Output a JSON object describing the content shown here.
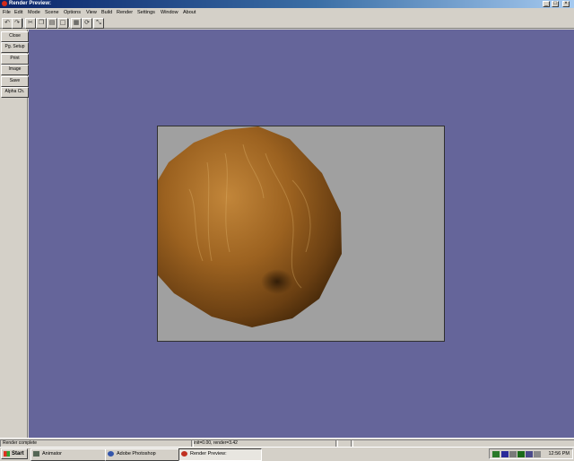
{
  "window": {
    "title": "Render Preview:",
    "icon": "app-icon",
    "controls": {
      "minimize": "_",
      "maximize": "□",
      "close": "×"
    }
  },
  "menu": [
    "File",
    "Edit",
    "Mode",
    "Scene",
    "Options",
    "View",
    "Build",
    "Render",
    "Settings",
    "Window",
    "About"
  ],
  "toolbar": {
    "icons": [
      "undo-icon",
      "redo-icon",
      "cut-icon",
      "copy-icon",
      "paste-icon",
      "page-icon",
      "grid-icon",
      "rotate-icon",
      "scale-icon"
    ]
  },
  "side_buttons": [
    "Close",
    "Pg. Setup",
    "Print",
    "Image",
    "Save",
    "Alpha Ch."
  ],
  "render": {
    "subject": "textured sphere",
    "colors": {
      "workspace": "#65659a",
      "frame": "#a0a0a0",
      "sphere": "#9a6020"
    }
  },
  "status": {
    "message": "Render complete",
    "timing": "init=0.00, render=3.42"
  },
  "taskbar": {
    "start_label": "Start",
    "tasks": [
      {
        "label": "Animator",
        "active": false
      },
      {
        "label": "Adobe Photoshop",
        "active": false
      },
      {
        "label": "Render Preview:",
        "active": true
      }
    ],
    "clock": "12:56 PM"
  }
}
